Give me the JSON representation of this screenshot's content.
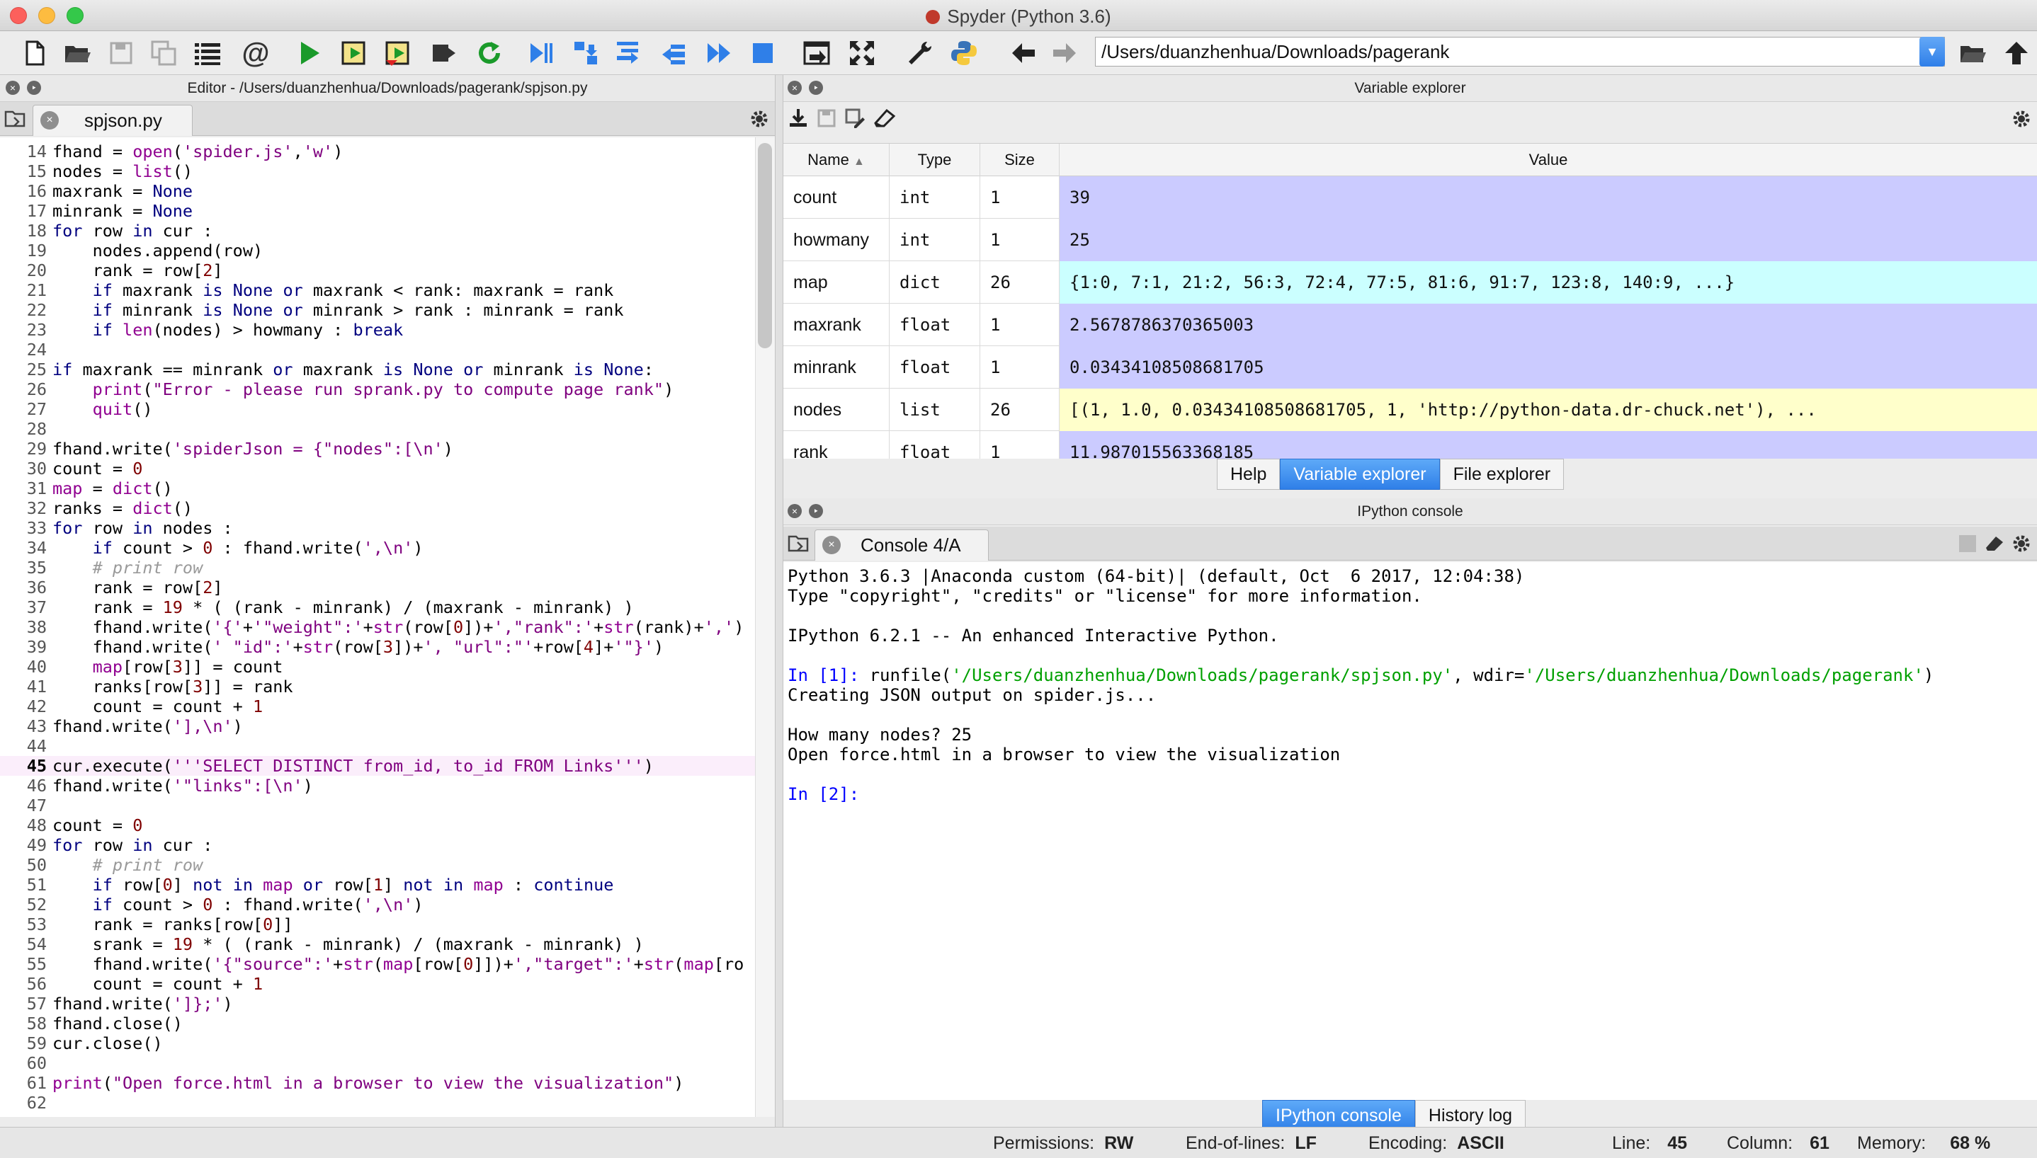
{
  "window": {
    "title": "Spyder (Python 3.6)"
  },
  "toolbar": {
    "path": "/Users/duanzhenhua/Downloads/pagerank",
    "icons": [
      "new-file-icon",
      "open-file-icon",
      "save-icon",
      "save-all-icon",
      "outline-icon",
      "at-icon",
      "run-icon",
      "run-cell-icon",
      "run-cell-advance-icon",
      "run-selection-icon",
      "rerun-icon",
      "debug-icon",
      "step-icon",
      "step-into-icon",
      "step-return-icon",
      "continue-icon",
      "stop-icon",
      "maximize-pane-icon",
      "fullscreen-icon",
      "wrench-icon",
      "python-path-icon",
      "back-icon",
      "forward-icon",
      "browse-folder-icon",
      "parent-folder-icon"
    ]
  },
  "editor": {
    "header": "Editor - /Users/duanzhenhua/Downloads/pagerank/spjson.py",
    "tab": "spjson.py",
    "lines": [
      {
        "n": "14",
        "t": "fhand = open('spider.js','w')"
      },
      {
        "n": "15",
        "t": "nodes = list()"
      },
      {
        "n": "16",
        "t": "maxrank = None"
      },
      {
        "n": "17",
        "t": "minrank = None"
      },
      {
        "n": "18",
        "t": "for row in cur :"
      },
      {
        "n": "19",
        "t": "    nodes.append(row)"
      },
      {
        "n": "20",
        "t": "    rank = row[2]"
      },
      {
        "n": "21",
        "t": "    if maxrank is None or maxrank < rank: maxrank = rank"
      },
      {
        "n": "22",
        "t": "    if minrank is None or minrank > rank : minrank = rank"
      },
      {
        "n": "23",
        "t": "    if len(nodes) > howmany : break"
      },
      {
        "n": "24",
        "t": ""
      },
      {
        "n": "25",
        "t": "if maxrank == minrank or maxrank is None or minrank is None:"
      },
      {
        "n": "26",
        "t": "    print(\"Error - please run sprank.py to compute page rank\")"
      },
      {
        "n": "27",
        "t": "    quit()"
      },
      {
        "n": "28",
        "t": ""
      },
      {
        "n": "29",
        "t": "fhand.write('spiderJson = {\"nodes\":[\\n')"
      },
      {
        "n": "30",
        "t": "count = 0"
      },
      {
        "n": "31",
        "t": "map = dict()"
      },
      {
        "n": "32",
        "t": "ranks = dict()"
      },
      {
        "n": "33",
        "t": "for row in nodes :"
      },
      {
        "n": "34",
        "t": "    if count > 0 : fhand.write(',\\n')"
      },
      {
        "n": "35",
        "t": "    # print row"
      },
      {
        "n": "36",
        "t": "    rank = row[2]"
      },
      {
        "n": "37",
        "t": "    rank = 19 * ( (rank - minrank) / (maxrank - minrank) )"
      },
      {
        "n": "38",
        "t": "    fhand.write('{'+'\"weight\":'+str(row[0])+',\"rank\":'+str(rank)+',')"
      },
      {
        "n": "39",
        "t": "    fhand.write(' \"id\":'+str(row[3])+', \"url\":\"'+row[4]+'\"}')"
      },
      {
        "n": "40",
        "t": "    map[row[3]] = count"
      },
      {
        "n": "41",
        "t": "    ranks[row[3]] = rank"
      },
      {
        "n": "42",
        "t": "    count = count + 1"
      },
      {
        "n": "43",
        "t": "fhand.write('],\\n')"
      },
      {
        "n": "44",
        "t": ""
      },
      {
        "n": "45",
        "t": "cur.execute('''SELECT DISTINCT from_id, to_id FROM Links''')"
      },
      {
        "n": "46",
        "t": "fhand.write('\"links\":[\\n')"
      },
      {
        "n": "47",
        "t": ""
      },
      {
        "n": "48",
        "t": "count = 0"
      },
      {
        "n": "49",
        "t": "for row in cur :"
      },
      {
        "n": "50",
        "t": "    # print row"
      },
      {
        "n": "51",
        "t": "    if row[0] not in map or row[1] not in map : continue"
      },
      {
        "n": "52",
        "t": "    if count > 0 : fhand.write(',\\n')"
      },
      {
        "n": "53",
        "t": "    rank = ranks[row[0]]"
      },
      {
        "n": "54",
        "t": "    srank = 19 * ( (rank - minrank) / (maxrank - minrank) )"
      },
      {
        "n": "55",
        "t": "    fhand.write('{\"source\":'+str(map[row[0]])+',\"target\":'+str(map[ro"
      },
      {
        "n": "56",
        "t": "    count = count + 1"
      },
      {
        "n": "57",
        "t": "fhand.write(']};')"
      },
      {
        "n": "58",
        "t": "fhand.close()"
      },
      {
        "n": "59",
        "t": "cur.close()"
      },
      {
        "n": "60",
        "t": ""
      },
      {
        "n": "61",
        "t": "print(\"Open force.html in a browser to view the visualization\")"
      },
      {
        "n": "62",
        "t": ""
      }
    ],
    "current_line": "45"
  },
  "variable_explorer": {
    "header": "Variable explorer",
    "columns": [
      "Name",
      "Type",
      "Size",
      "Value"
    ],
    "rows": [
      {
        "name": "count",
        "type": "int",
        "size": "1",
        "value": "39",
        "color": "#cbcbff"
      },
      {
        "name": "howmany",
        "type": "int",
        "size": "1",
        "value": "25",
        "color": "#cbcbff"
      },
      {
        "name": "map",
        "type": "dict",
        "size": "26",
        "value": "{1:0, 7:1, 21:2, 56:3, 72:4, 77:5, 81:6, 91:7, 123:8, 140:9, ...}",
        "color": "#cbffff"
      },
      {
        "name": "maxrank",
        "type": "float",
        "size": "1",
        "value": "2.5678786370365003",
        "color": "#cbcbff"
      },
      {
        "name": "minrank",
        "type": "float",
        "size": "1",
        "value": "0.03434108508681705",
        "color": "#cbcbff"
      },
      {
        "name": "nodes",
        "type": "list",
        "size": "26",
        "value": "[(1, 1.0, 0.03434108508681705, 1, 'http://python-data.dr-chuck.net'), ...",
        "color": "#ffffcb"
      },
      {
        "name": "rank",
        "type": "float",
        "size": "1",
        "value": "11.987015563368185",
        "color": "#cbcbff"
      }
    ],
    "tabs": [
      "Help",
      "Variable explorer",
      "File explorer"
    ],
    "active_tab": "Variable explorer"
  },
  "console": {
    "header": "IPython console",
    "tab": "Console 4/A",
    "lines": [
      {
        "t": "Python 3.6.3 |Anaconda custom (64-bit)| (default, Oct  6 2017, 12:04:38)"
      },
      {
        "t": "Type \"copyright\", \"credits\" or \"license\" for more information."
      },
      {
        "t": ""
      },
      {
        "t": "IPython 6.2.1 -- An enhanced Interactive Python."
      },
      {
        "t": ""
      },
      {
        "t": "In [1]: runfile('/Users/duanzhenhua/Downloads/pagerank/spjson.py', wdir='/Users/duanzhenhua/Downloads/pagerank')"
      },
      {
        "t": "Creating JSON output on spider.js..."
      },
      {
        "t": ""
      },
      {
        "t": "How many nodes? 25"
      },
      {
        "t": "Open force.html in a browser to view the visualization"
      },
      {
        "t": ""
      },
      {
        "t": "In [2]: "
      }
    ],
    "tabs": [
      "IPython console",
      "History log"
    ],
    "active_tab": "IPython console"
  },
  "statusbar": {
    "permissions_label": "Permissions:",
    "permissions": "RW",
    "eol_label": "End-of-lines:",
    "eol": "LF",
    "encoding_label": "Encoding:",
    "encoding": "ASCII",
    "line_label": "Line:",
    "line": "45",
    "column_label": "Column:",
    "column": "61",
    "memory_label": "Memory:",
    "memory": "68 %"
  }
}
